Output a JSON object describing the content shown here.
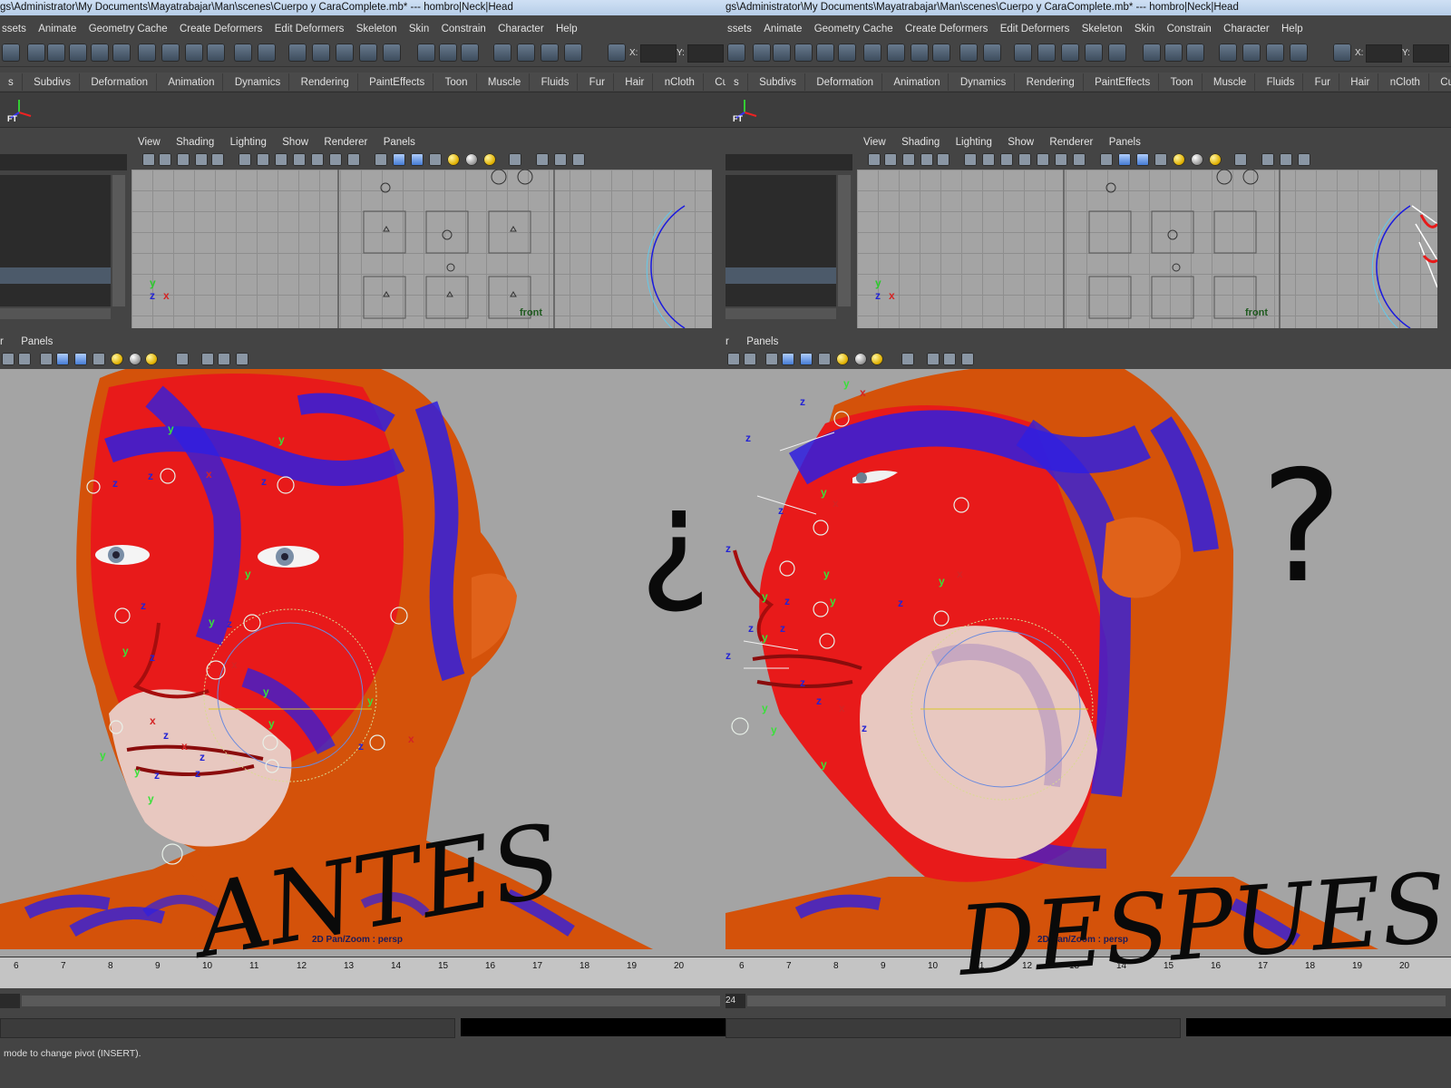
{
  "window": {
    "left_title": "gs\\Administrator\\My Documents\\Mayatrabajar\\Man\\scenes\\Cuerpo y CaraComplete.mb*   ---   hombro|Neck|Head",
    "right_title": "gs\\Administrator\\My Documents\\Mayatrabajar\\Man\\scenes\\Cuerpo y CaraComplete.mb*   ---   hombro|Neck|Head"
  },
  "menus": {
    "main": [
      "ssets",
      "Animate",
      "Geometry Cache",
      "Create Deformers",
      "Edit Deformers",
      "Skeleton",
      "Skin",
      "Constrain",
      "Character",
      "Help"
    ]
  },
  "status_line": {
    "x_label": "X:",
    "y_label": "Y:"
  },
  "shelf": {
    "tabs": [
      "s",
      "Subdivs",
      "Deformation",
      "Animation",
      "Dynamics",
      "Rendering",
      "PaintEffects",
      "Toon",
      "Muscle",
      "Fluids",
      "Fur",
      "Hair",
      "nCloth",
      "Cus"
    ],
    "icon_label": "FT"
  },
  "front_panel": {
    "menu": [
      "View",
      "Shading",
      "Lighting",
      "Show",
      "Renderer",
      "Panels"
    ],
    "camera_label": "front",
    "axis_y": "y",
    "axis_z": "z",
    "axis_x": "x"
  },
  "persp_panel": {
    "left_menu_fragment": "r",
    "menu_panels": "Panels",
    "camera_caption": "2D Pan/Zoom : persp"
  },
  "time_slider": {
    "ticks": [
      "6",
      "7",
      "8",
      "9",
      "10",
      "11",
      "12",
      "13",
      "14",
      "15",
      "16",
      "17",
      "18",
      "19",
      "20"
    ]
  },
  "range_slider": {
    "end_field": "24"
  },
  "help_line": {
    "text": "mode to change pivot (INSERT)."
  },
  "annotations": {
    "before": "ANTES",
    "after": "DESPUES",
    "open_question": "¿",
    "close_question": "?"
  },
  "colors": {
    "weight_red": "#e81a1a",
    "weight_blue": "#2f1fe0",
    "skin_orange": "#d4520a",
    "skin_pale": "#e8c8c0",
    "viewport_gray": "#a4a4a4"
  }
}
